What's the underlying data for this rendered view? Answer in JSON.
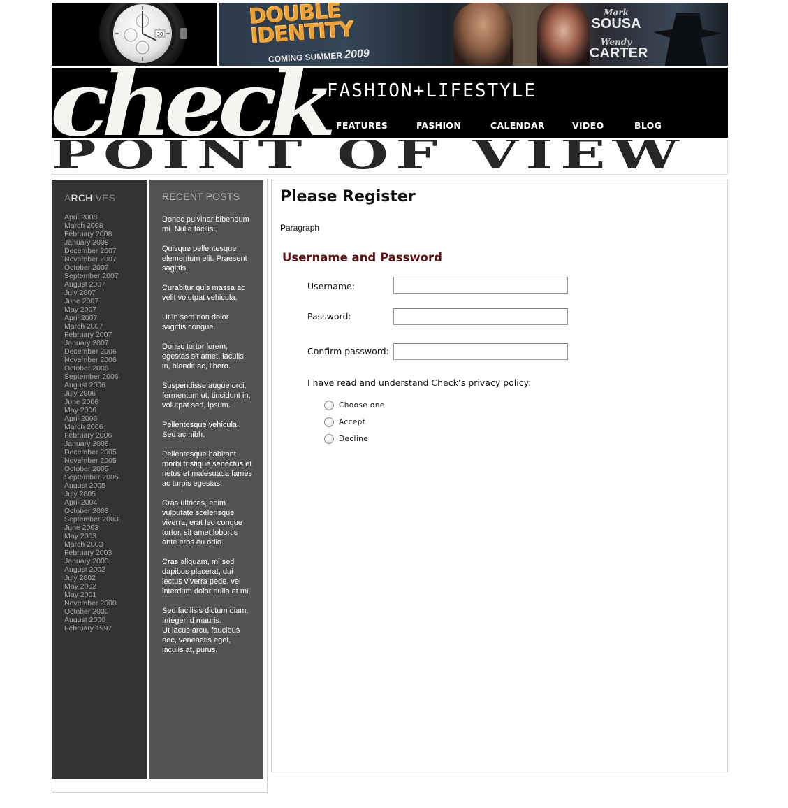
{
  "banner": {
    "watch_ad": {
      "dial_number": "30"
    },
    "movie_ad": {
      "title_line1": "DOUBLE",
      "title_line2": "IDENTITY",
      "subtitle": "COMING SUMMER",
      "year": "2009",
      "cast": [
        {
          "first": "Mark",
          "last": "SOUSA"
        },
        {
          "first": "Wendy",
          "last": "CARTER"
        }
      ]
    }
  },
  "header": {
    "logo": "check",
    "tagline": "FASHION+LIFESTYLE",
    "nav": [
      "FEATURES",
      "FASHION",
      "CALENDAR",
      "VIDEO",
      "BLOG"
    ]
  },
  "pov_banner": "POINT OF VIEW",
  "archives": {
    "heading_dim1": "A",
    "heading_highlight": "RCH",
    "heading_dim2": "IVES",
    "months": [
      "April 2008",
      "March 2008",
      "February 2008",
      "January 2008",
      "December 2007",
      "November 2007",
      "October 2007",
      "September 2007",
      "August 2007",
      "July 2007",
      "June 2007",
      "May 2007",
      "April 2007",
      "March 2007",
      "February 2007",
      "January 2007",
      "December 2006",
      "November 2006",
      "October 2006",
      "September 2006",
      "August 2006",
      "July 2006",
      "June 2006",
      "May 2006",
      "April 2006",
      "March 2006",
      "February 2006",
      "January 2006",
      "December 2005",
      "November 2005",
      "October 2005",
      "September 2005",
      "August 2005",
      "July 2005",
      "April 2004",
      "October 2003",
      "September 2003",
      "June 2003",
      "May 2003",
      "March 2003",
      "February 2003",
      "January 2003",
      "August 2002",
      "July 2002",
      "May 2002",
      "May 2001",
      "November 2000",
      "October 2000",
      "August 2000",
      "February 1997"
    ]
  },
  "recent_posts": {
    "heading": "RECENT POSTS",
    "posts": [
      "Donec pulvinar bibendum mi. Nulla facilisi.",
      "Quisque pellentesque elementum elit. Praesent sagittis.",
      "Curabitur quis massa ac velit volutpat vehicula.",
      "Ut in sem non dolor sagittis congue.",
      "Donec tortor lorem, egestas sit amet, iaculis in, blandit ac, libero.",
      "Suspendisse augue orci, fermentum ut, tincidunt in, volutpat sed, ipsum.",
      "Pellentesque vehicula. Sed ac nibh.",
      "Pellentesque habitant morbi tristique senectus et netus et malesuada fames ac turpis egestas.",
      "Cras ultrices, enim vulputate scelerisque viverra, erat leo congue tortor, sit amet lobortis ante eros eu odio.",
      "Cras aliquam, mi sed dapibus placerat, dui lectus viverra pede, vel interdum dolor nulla et mi.",
      "Sed facilisis dictum diam. Integer id mauris.",
      "Ut lacus arcu, faucibus nec, venenatis eget, iaculis at, purus."
    ]
  },
  "main": {
    "title": "Please Register",
    "intro": "Paragraph",
    "section_title": "Username and Password",
    "fields": [
      {
        "label": "Username:",
        "value": ""
      },
      {
        "label": "Password:",
        "value": ""
      },
      {
        "label": "Confirm password:",
        "value": ""
      }
    ],
    "policy_question": "I have read and understand Check’s privacy policy:",
    "policy_options": [
      "Choose one",
      "Accept",
      "Decline"
    ]
  }
}
